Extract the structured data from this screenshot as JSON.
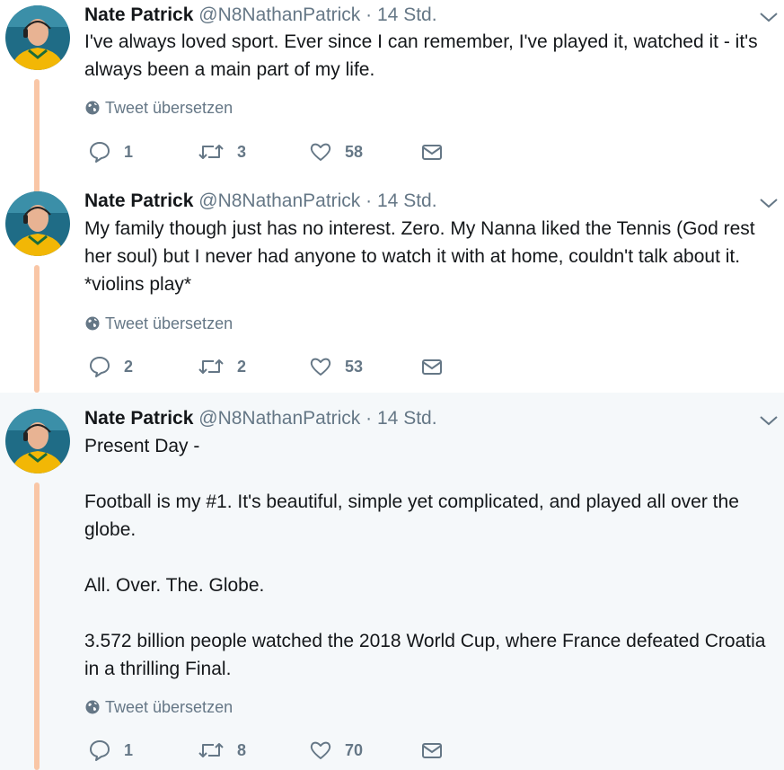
{
  "translate_label": "Tweet übersetzen",
  "colors": {
    "thread_line": "#f9c6a6",
    "muted": "#657786",
    "text": "#14171a",
    "highlight_bg": "#f5f8fa"
  },
  "tweets": [
    {
      "author": {
        "name": "Nate Patrick",
        "handle": "@N8NathanPatrick"
      },
      "separator": "·",
      "time": "14 Std.",
      "body": [
        "I've always loved sport. Ever since I can remember, I've played it, watched it - it's always been a main part of my life."
      ],
      "stats": {
        "replies": "1",
        "retweets": "3",
        "likes": "58"
      }
    },
    {
      "author": {
        "name": "Nate Patrick",
        "handle": "@N8NathanPatrick"
      },
      "separator": "·",
      "time": "14 Std.",
      "body": [
        "My family though just has no interest. Zero. My Nanna liked the Tennis (God rest her soul) but I never had anyone to watch it with at home, couldn't talk about it. *violins play*"
      ],
      "stats": {
        "replies": "2",
        "retweets": "2",
        "likes": "53"
      }
    },
    {
      "author": {
        "name": "Nate Patrick",
        "handle": "@N8NathanPatrick"
      },
      "separator": "·",
      "time": "14 Std.",
      "body": [
        "Present Day -",
        "Football is my #1. It's beautiful, simple yet complicated, and played all over the globe.",
        "All. Over. The. Globe.",
        "3.572 billion people watched the 2018 World Cup, where France defeated Croatia in a thrilling Final."
      ],
      "stats": {
        "replies": "1",
        "retweets": "8",
        "likes": "70"
      }
    }
  ]
}
